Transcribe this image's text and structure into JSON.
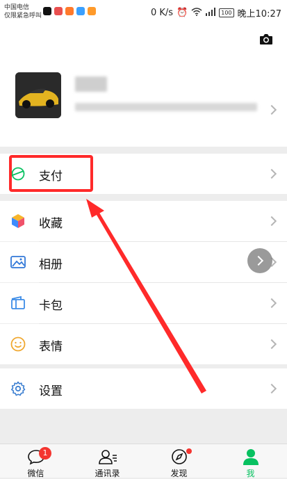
{
  "status": {
    "carrier_line1": "中国电信",
    "carrier_line2": "仅限紧急呼叫",
    "speed": "0 K/s",
    "battery": "100",
    "time": "晚上10:27"
  },
  "menu": {
    "pay": "支付",
    "favorites": "收藏",
    "album": "相册",
    "card": "卡包",
    "emoji": "表情",
    "settings": "设置"
  },
  "tabs": {
    "chats": "微信",
    "contacts": "通讯录",
    "discover": "发现",
    "me": "我"
  },
  "badges": {
    "chats": "1"
  },
  "colors": {
    "accent": "#07c160",
    "highlight": "#ff2a2a",
    "badge": "#f43530"
  }
}
